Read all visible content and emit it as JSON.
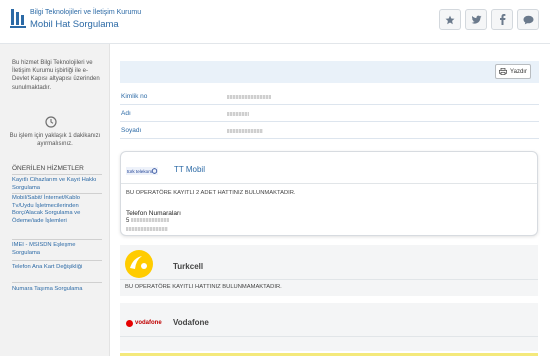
{
  "header": {
    "org": "Bilgi Teknolojileri ve İletişim Kurumu",
    "title": "Mobil Hat Sorgulama",
    "share_buttons": [
      "star-icon",
      "twitter-icon",
      "facebook-icon",
      "comment-icon"
    ]
  },
  "sidebar": {
    "intro": "Bu hizmet Bilgi Teknolojileri ve İletişim Kurumu işbirliği ile e-Devlet Kapısı altyapısı üzerinden sunulmaktadır.",
    "duration": "Bu işlem için yaklaşık 1 dakikanızı ayırmalısınız.",
    "services_heading": "ÖNERİLEN HİZMETLER",
    "services": [
      {
        "label": "Kayıtlı Cihazlarım ve Kayıt Hakkı Sorgulama"
      },
      {
        "label": "Mobil/Sabit/ İnternet/Kablo Tv/Uydu İşletmecilerinden Borç/Alacak Sorgulama ve Ödeme/iade İşlemleri"
      },
      {
        "label": "IMEI - MSISDN Eşleşme Sorgulama"
      },
      {
        "label": "Telefon Ana Kart Değişikliği"
      },
      {
        "label": "Numara Taşıma Sorgulama"
      }
    ]
  },
  "toolbar": {
    "print_label": "Yazdır"
  },
  "fields": [
    {
      "label": "Kimlik no"
    },
    {
      "label": "Adı"
    },
    {
      "label": "Soyadı"
    }
  ],
  "operators": {
    "ttmobil": {
      "name": "TT Mobil",
      "logo_text": "türk telekom",
      "message": "BU OPERATÖRE KAYITLI 2 ADET HATTINIZ BULUNMAKTADIR.",
      "phones_label": "Telefon Numaraları",
      "phone_prefix": "5"
    },
    "turkcell": {
      "name": "Turkcell",
      "message": "BU OPERATÖRE KAYITLI HATTINIZ BULUNMAMAKTADIR."
    },
    "vodafone": {
      "name": "Vodafone",
      "logo_text": "vodafone"
    }
  },
  "colors": {
    "accent": "#2c6aa6",
    "turkcell_yellow": "#ffcc00",
    "vodafone_red": "#e60000"
  }
}
